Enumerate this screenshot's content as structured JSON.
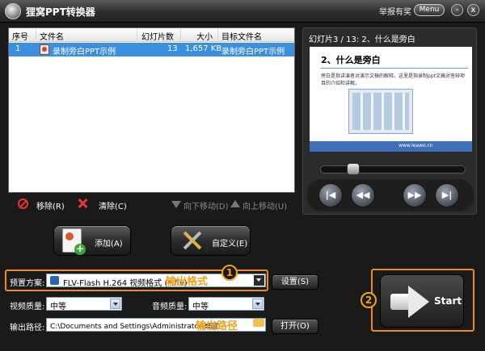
{
  "app": {
    "title": "狸窝PPT转换器",
    "report": "举报有奖",
    "menu": "Menu",
    "minimize": "-",
    "close": "x"
  },
  "list": {
    "headers": {
      "index": "序号",
      "filename": "文件名",
      "slides": "幻灯片数",
      "size": "大小",
      "target": "目标文件名"
    },
    "rows": [
      {
        "index": "1",
        "filename": "录制旁白PPT示例",
        "slides": "13",
        "size": "1,657 KB",
        "target": "录制旁白PPT示例"
      }
    ]
  },
  "toolbar": {
    "remove": "移除(R)",
    "clear": "清除(C)",
    "move_down": "向下移动(D)",
    "move_up": "向上移动(U)"
  },
  "actions": {
    "add": "添加(A)",
    "custom": "自定义(E)"
  },
  "preview": {
    "header": "幻灯片3 / 13: 2、什么是旁白",
    "slide_title": "2、什么是旁白",
    "slide_text": "旁白是指讲演者对演示文稿的解释，这里是指录制ppt文稿对答辩项目的介绍和讲解。",
    "slide_footer": "www.leawo.cn",
    "progress": 0.2,
    "controls": {
      "first": "|◀",
      "rewind": "◀◀",
      "forward": "▶▶",
      "last": "▶|"
    }
  },
  "settings": {
    "preset_label": "预置方案:",
    "preset_value": "FLV-Flash H.264 视频格式 (*.flv)",
    "preset_annotation": "输出格式",
    "settings_button": "设置(S)",
    "video_quality_label": "视频质量:",
    "video_quality_value": "中等",
    "audio_quality_label": "音频质量:",
    "audio_quality_value": "中等",
    "output_label": "输出路径:",
    "output_value": "C:\\Documents and Settings\\Administrator\\桌面",
    "output_annotation": "输出路径",
    "open_button": "打开(O)",
    "marker_1": "1",
    "marker_2": "2"
  },
  "start": {
    "label": "Start"
  },
  "colors": {
    "highlight": "#f08a1a",
    "selection": "#3b8fdc",
    "annotation": "#f2a11c"
  }
}
